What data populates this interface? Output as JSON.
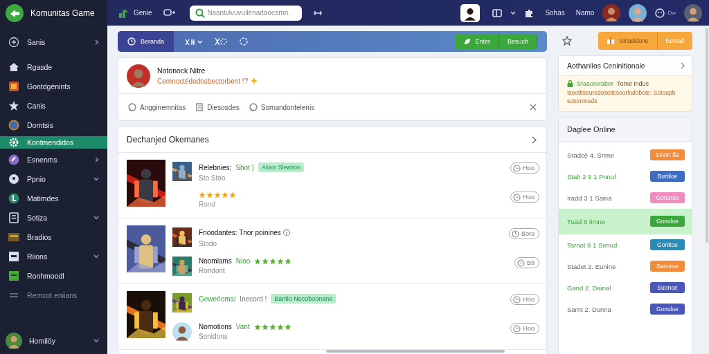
{
  "app": {
    "title": "Komunitas Game"
  },
  "topbar": {
    "nav_label": "Genie",
    "search": {
      "placeholder": "Nsantvlvuvuilenadaocamn."
    },
    "links": [
      "Sohas",
      "Namo"
    ],
    "status": "Dw"
  },
  "sidebar": {
    "items": [
      {
        "label": "Sanis",
        "selected": false,
        "disabled": false,
        "expanded": false
      },
      {
        "label": "Rgasde",
        "selected": false,
        "disabled": false
      },
      {
        "label": "Gontdgénints",
        "selected": false,
        "disabled": false
      },
      {
        "label": "Canis",
        "selected": false,
        "disabled": false
      },
      {
        "label": "Domtsis",
        "selected": false,
        "disabled": false
      },
      {
        "label": "Kontmendidos",
        "selected": true,
        "disabled": false
      },
      {
        "label": "Esnenms",
        "selected": false,
        "disabled": false,
        "expanded": false
      },
      {
        "label": "Ppnio",
        "selected": false,
        "disabled": false,
        "expanded": true
      },
      {
        "label": "Matimdes",
        "selected": false,
        "disabled": false
      },
      {
        "label": "Sotiza",
        "selected": false,
        "disabled": false,
        "expanded": true
      },
      {
        "label": "Bradios",
        "selected": false,
        "disabled": false
      },
      {
        "label": "Riions",
        "selected": false,
        "disabled": false,
        "expanded": true
      },
      {
        "label": "Ronhmoodl",
        "selected": false,
        "disabled": false
      },
      {
        "label": "Remcot eniians",
        "selected": false,
        "disabled": true
      }
    ],
    "user": {
      "name": "Homilöy",
      "expanded": true
    }
  },
  "toolbar": {
    "tabs": [
      {
        "label": "Beranda",
        "selected": true
      }
    ],
    "buttons": [
      "Enter",
      "Besuch"
    ]
  },
  "post": {
    "author": "Notonock Nitre",
    "subtitle": "Cemnoctédodosbectorbent !?",
    "actions": [
      "Angginemnitas",
      "Diesosdes",
      "Somandontelenis"
    ]
  },
  "feed": {
    "title": "Dechanjed Okemanes",
    "groups": [
      {
        "items": [
          {
            "kind": "picture",
            "title": "Relebnies;",
            "tag": "Shot )",
            "badge": "Aloor Sleation",
            "subtitle": "Sto Stoo",
            "action": "Hoo"
          },
          {
            "kind": "plain",
            "stars": 5,
            "color": "#f0a81c",
            "subtitle": "Rond",
            "action": "Hoo"
          }
        ]
      },
      {
        "items": [
          {
            "kind": "picture",
            "title": "Fnoodantes: Tnor poinines ⓘ",
            "subtitle": "Stodo",
            "action": "Boro"
          },
          {
            "kind": "picture",
            "title": "Noomlams",
            "tag": "Nioo",
            "stars": 5,
            "color": "#5bb030",
            "subtitle": "Rondont",
            "action": "B9"
          }
        ]
      },
      {
        "items": [
          {
            "kind": "picture",
            "accent": true,
            "title": "Gewerlomal",
            "tag": "Inecord !",
            "badge": "Bantio Necoboonane",
            "action": "Hoo"
          },
          {
            "kind": "avatar",
            "title": "Nomotions",
            "tag": "Vant",
            "stars": 5,
            "color": "#5bb030",
            "subtitle": "Sonidons",
            "action": "Hoo"
          }
        ]
      }
    ]
  },
  "aside": {
    "buttons": [
      "Sinasidone",
      "Eestad"
    ],
    "card": {
      "title": "Aothanlios Ceninitionale",
      "notice_lead": "Sraaororaber",
      "notice_tail": "Tome indus",
      "notice_body": "Isoottiseuredoseitcsoorlodobote: Sotoupb sotomineds"
    },
    "online": {
      "title": "Daglee Online",
      "rows": [
        {
          "label": "Sradcé 4. Srime",
          "active": false,
          "selected": false,
          "badge": "Sinnrt ße",
          "color": "#f08c3a"
        },
        {
          "label": "Stah 2 9 1 Pnnol",
          "active": true,
          "selected": false,
          "badge": "Burtiloe",
          "color": "#3d6cc4"
        },
        {
          "label": "Iradd 3 1 Saina",
          "active": false,
          "selected": false,
          "badge": "Gonoroe",
          "color": "#f08cc0"
        },
        {
          "label": "Tuad 6 Iimne",
          "active": true,
          "selected": true,
          "badge": "Gonoloe",
          "color": "#3aa73a"
        },
        {
          "label": "Tarnot 9 1 Senud",
          "active": true,
          "selected": false,
          "badge": "Gonitoe",
          "color": "#2a8ab8"
        },
        {
          "label": "Stadet 2. Eunine",
          "active": false,
          "selected": false,
          "badge": "Sanoroe",
          "color": "#f08c3a"
        },
        {
          "label": "Gand 2. Dainal",
          "active": true,
          "selected": false,
          "badge": "Suonoe",
          "color": "#4a56b8"
        },
        {
          "label": "Sarnt 2. Dunna",
          "active": false,
          "selected": false,
          "badge": "Gonoloe",
          "color": "#4a56b8"
        }
      ]
    }
  }
}
